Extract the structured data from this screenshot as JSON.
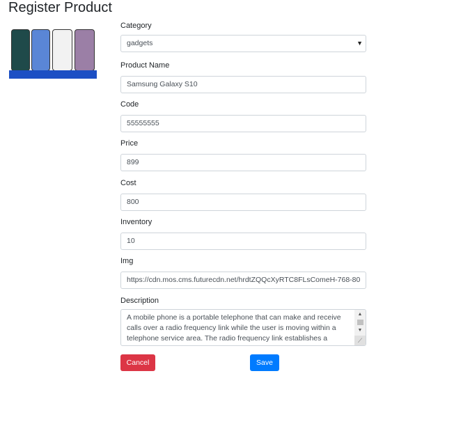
{
  "page": {
    "title": "Register Product"
  },
  "form": {
    "category": {
      "label": "Category",
      "value": "gadgets"
    },
    "product_name": {
      "label": "Product Name",
      "value": "Samsung Galaxy S10"
    },
    "code": {
      "label": "Code",
      "value": "55555555"
    },
    "price": {
      "label": "Price",
      "value": "899"
    },
    "cost": {
      "label": "Cost",
      "value": "800"
    },
    "inventory": {
      "label": "Inventory",
      "value": "10"
    },
    "img": {
      "label": "Img",
      "value": "https://cdn.mos.cms.futurecdn.net/hrdtZQQcXyRTC8FLsComeH-768-80"
    },
    "description": {
      "label": "Description",
      "value": "A mobile phone is a portable telephone that can make and receive calls over a radio frequency link while the user is moving within a telephone service area. The radio frequency link establishes a"
    }
  },
  "buttons": {
    "cancel": "Cancel",
    "save": "Save"
  },
  "colors": {
    "cancel": "#dc3545",
    "save": "#007bff",
    "image_band": "#1c4fc4"
  },
  "icons": {
    "select_arrow": "caret-down-icon",
    "scroll_up": "scroll-up-icon",
    "scroll_down": "scroll-down-icon",
    "resize": "resize-grip-icon"
  }
}
